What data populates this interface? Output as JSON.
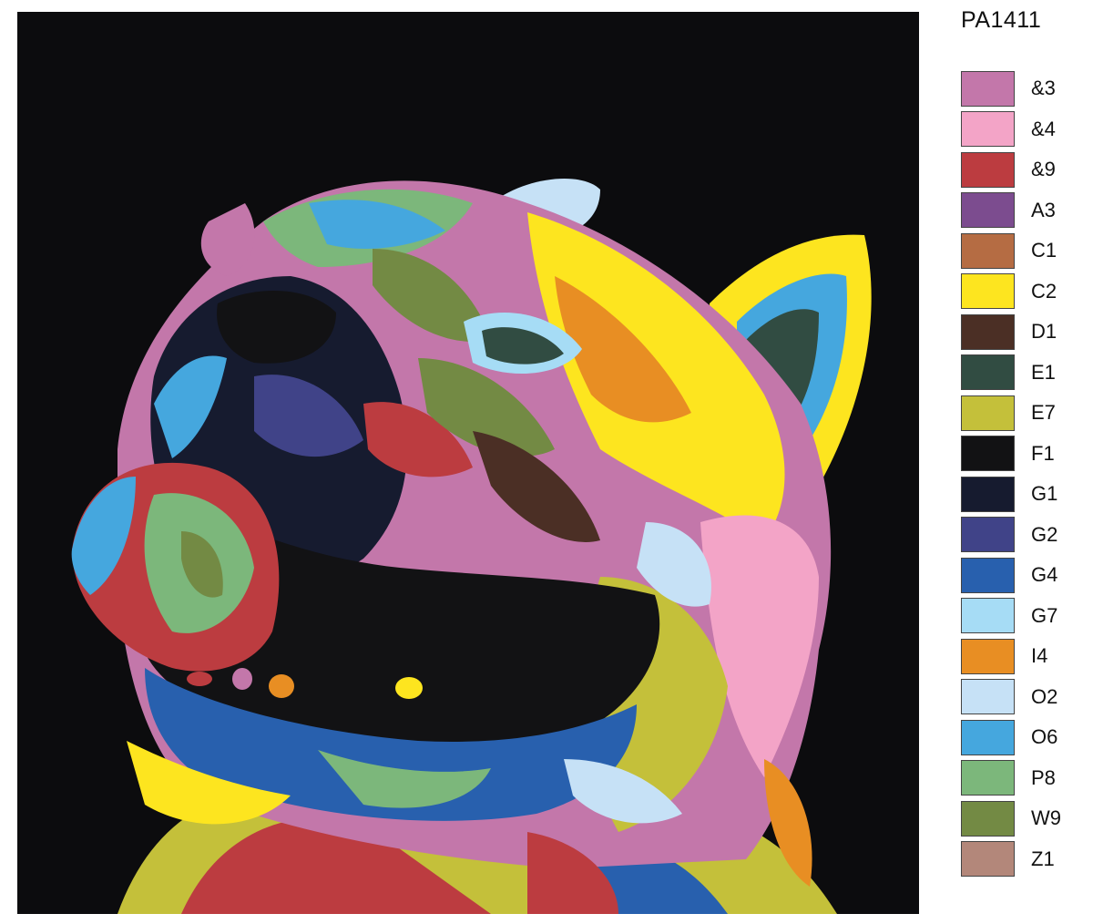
{
  "code": "PA1411",
  "artwork": {
    "icon": "rainbow-pop-art-pug-illustration"
  },
  "legend": [
    {
      "label": "&3",
      "color": "#c377aa"
    },
    {
      "label": "&4",
      "color": "#f3a4c7"
    },
    {
      "label": "&9",
      "color": "#bc3c40"
    },
    {
      "label": "A3",
      "color": "#7c4c8f"
    },
    {
      "label": "C1",
      "color": "#b56c43"
    },
    {
      "label": "C2",
      "color": "#fde51f"
    },
    {
      "label": "D1",
      "color": "#4b2f25"
    },
    {
      "label": "E1",
      "color": "#314c42"
    },
    {
      "label": "E7",
      "color": "#c4c03a"
    },
    {
      "label": "F1",
      "color": "#121214"
    },
    {
      "label": "G1",
      "color": "#161b2f"
    },
    {
      "label": "G2",
      "color": "#404388"
    },
    {
      "label": "G4",
      "color": "#2860ae"
    },
    {
      "label": "G7",
      "color": "#a6dcf5"
    },
    {
      "label": "I4",
      "color": "#e88e23"
    },
    {
      "label": "O2",
      "color": "#c6e1f6"
    },
    {
      "label": "O6",
      "color": "#45a7de"
    },
    {
      "label": "P8",
      "color": "#7cb77b"
    },
    {
      "label": "W9",
      "color": "#738a44"
    },
    {
      "label": "Z1",
      "color": "#b3877a"
    }
  ]
}
